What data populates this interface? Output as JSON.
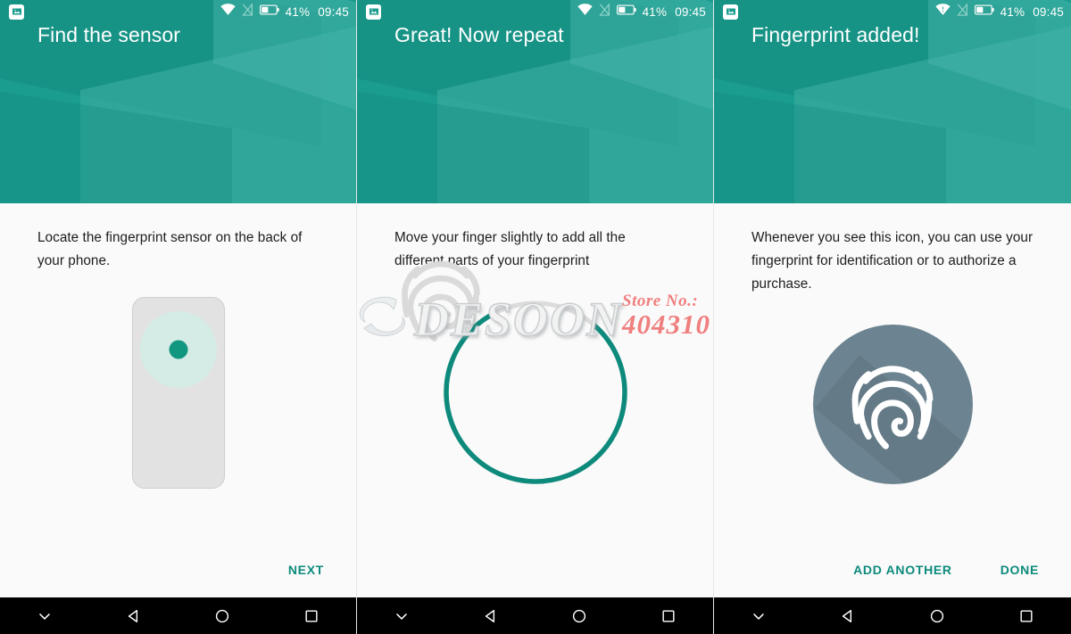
{
  "meta": {
    "app": "Android Fingerprint Setup",
    "accent_teal": "#1a9c8e",
    "action_text_color": "#0c8a7c",
    "body_bg": "#fafafa",
    "navbar_bg": "#000000",
    "done_circle_color": "#6c8491"
  },
  "status_bar": {
    "image_icon": "image-icon",
    "wifi_icon": "wifi-icon",
    "signal_off_icon": "signal-no-service-icon",
    "battery_icon": "battery-icon",
    "battery_percent": "41%",
    "time": "09:45"
  },
  "navbar": {
    "hide_icon": "chevron-down-icon",
    "back_icon": "back-triangle-icon",
    "home_icon": "home-circle-icon",
    "recents_icon": "recents-square-icon"
  },
  "panels": [
    {
      "title": "Find the sensor",
      "description": "Locate the fingerprint sensor on the back of your phone.",
      "illustration": "phone-with-rear-sensor",
      "actions": [
        {
          "label": "NEXT",
          "name": "next-button"
        }
      ]
    },
    {
      "title": "Great! Now repeat",
      "description": "Move your finger slightly to add all the different parts of your fingerprint",
      "illustration": "fingerprint-progress-ring",
      "progress_percent": 80,
      "actions": []
    },
    {
      "title": "Fingerprint added!",
      "description": "Whenever you see this icon, you can use your fingerprint for identification or to authorize a purchase.",
      "illustration": "fingerprint-badge-circle",
      "actions": [
        {
          "label": "ADD ANOTHER",
          "name": "add-another-button"
        },
        {
          "label": "DONE",
          "name": "done-button"
        }
      ]
    }
  ],
  "watermark": {
    "brand": "DESOON",
    "store_label": "Store No.:",
    "store_number": "404310"
  }
}
